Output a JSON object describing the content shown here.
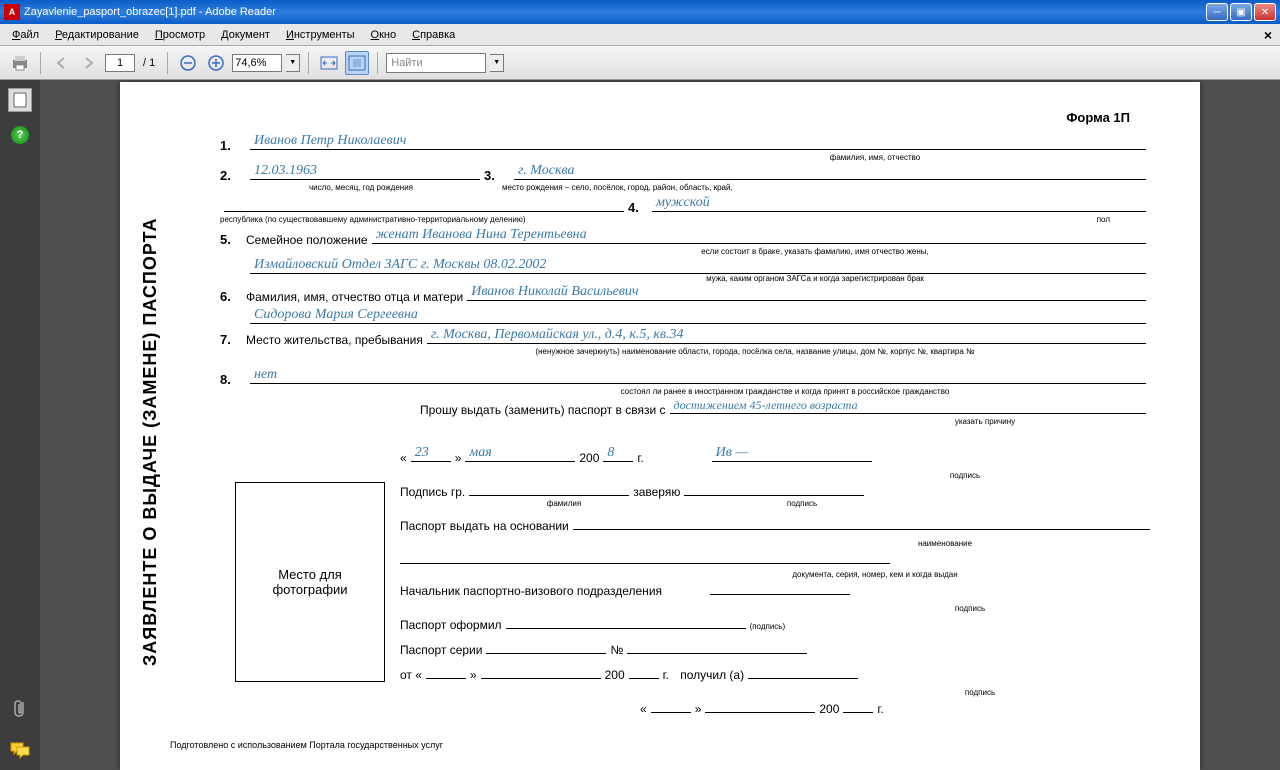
{
  "titlebar": {
    "filename": "Zayavlenie_pasport_obrazec[1].pdf - Adobe Reader"
  },
  "menu": {
    "file": "Файл",
    "edit": "Редактирование",
    "view": "Просмотр",
    "document": "Документ",
    "tools": "Инструменты",
    "window": "Окно",
    "help": "Справка"
  },
  "toolbar": {
    "page_current": "1",
    "page_sep": "/",
    "page_total": "1",
    "zoom": "74,6%",
    "find_placeholder": "Найти"
  },
  "doc": {
    "form_number": "Форма 1П",
    "vertical_title": "ЗАЯВЛЕНТЕ О ВЫДАЧЕ (ЗАМЕНЕ) ПАСПОРТА",
    "field1": {
      "num": "1.",
      "value": "Иванов  Петр  Николаевич",
      "hint": "фамилия, имя, отчество"
    },
    "field2": {
      "num": "2.",
      "value": "12.03.1963",
      "hint": "число, месяц, год рождения"
    },
    "field3": {
      "num": "3.",
      "value": "г. Москва",
      "hint": "место рождения – село, посёлок, город, район, область, край,"
    },
    "field3b": {
      "hint": "республика (по существовавшему административно-территориальному делению)"
    },
    "field4": {
      "num": "4.",
      "value": "мужской",
      "hint": "пол"
    },
    "field5": {
      "num": "5.",
      "label": "Семейное положение",
      "value": "женат    Иванова  Нина  Терентьевна",
      "hint": "если состоит в браке, указать фамилию, имя отчество жены,"
    },
    "field5b": {
      "value": "Измайловский Отдел  ЗАГС  г. Москвы   08.02.2002",
      "hint": "мужа, каким органом ЗАГСа и когда зарегистрирован брак"
    },
    "field6": {
      "num": "6.",
      "label": "Фамилия, имя, отчество отца и матери",
      "value": "Иванов  Николай  Васильевич"
    },
    "field6b": {
      "value": "Сидорова  Мария  Сергеевна"
    },
    "field7": {
      "num": "7.",
      "label": "Место жительства, пребывания",
      "value": "г. Москва,  Первомайская  ул., д.4, к.5, кв.34",
      "hint": "(ненужное зачеркнуть) наименование области, города, посёлка села, название улицы, дом №, корпус №, квартира №"
    },
    "field8": {
      "num": "8.",
      "value": "нет",
      "hint": "состоял ли ранее в иностранном гражданстве и когда принят в российское гражданство"
    },
    "request": {
      "label": "Прошу выдать (заменить) паспорт в связи с",
      "value": "достижением 45-летнего возраста",
      "hint": "указать причину"
    },
    "date": {
      "day": "23",
      "month": "мая",
      "year_prefix": "200",
      "year": "8",
      "year_suffix": "г.",
      "sign": "Ив —",
      "sign_hint": "подпись"
    },
    "sign_line": {
      "label": "Подпись гр.",
      "hint1": "фамилия",
      "label2": "заверяю",
      "hint2": "подпись"
    },
    "basis": {
      "label": "Паспорт выдать на основании",
      "hint": "наименование"
    },
    "basis2_hint": "документа, серия, номер, кем и когда выдан",
    "chief": {
      "label": "Начальник паспортно-визового подразделения",
      "hint": "подпись"
    },
    "issued": {
      "label": "Паспорт оформил",
      "hint": "(подпись)"
    },
    "series": {
      "label": "Паспорт серии",
      "num_label": "№"
    },
    "from": {
      "label": "от «",
      "label2": "»",
      "year_prefix": "200",
      "year_suffix": "г.",
      "received": "получил (а)",
      "hint": "подпись"
    },
    "bottom_date": {
      "open": "«",
      "close": "»",
      "year_prefix": "200",
      "year_suffix": "г."
    },
    "photo_label": "Место для\nфотографии",
    "footer": "Подготовлено с использованием Портала государственных услуг"
  }
}
